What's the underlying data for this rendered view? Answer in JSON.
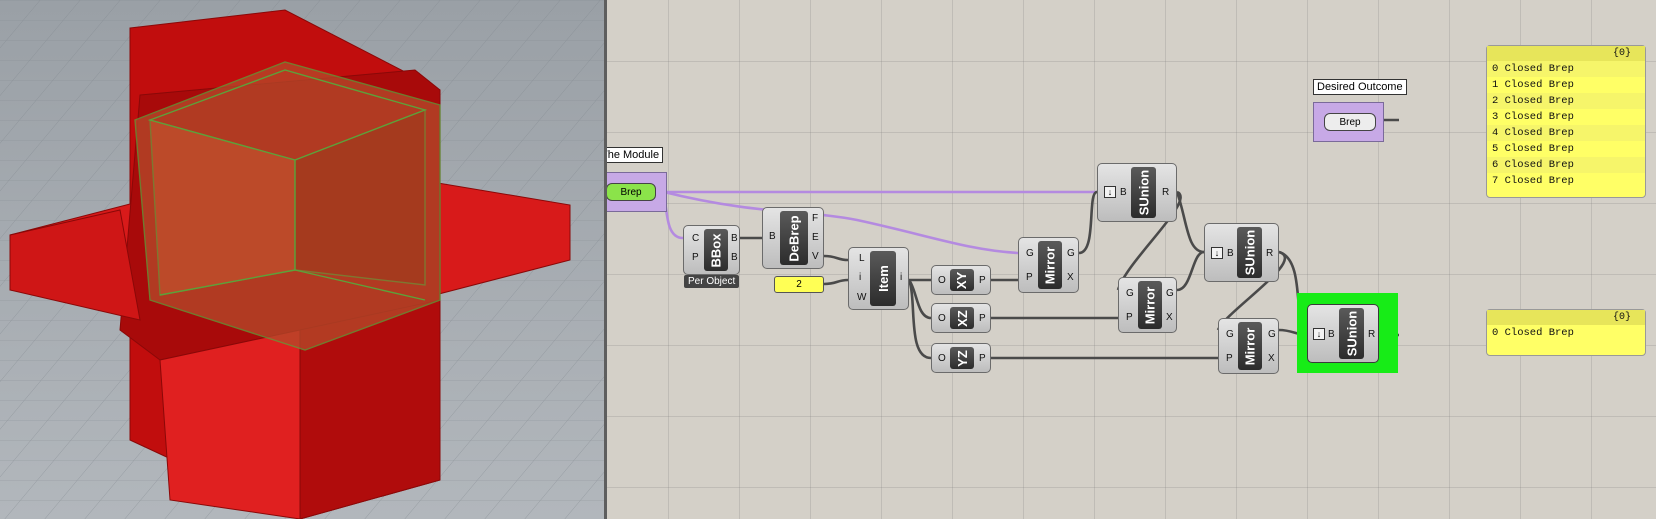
{
  "viewport": {
    "label": "Rhino 3D viewport",
    "object_color": "#d11414"
  },
  "canvas": {
    "wire_color": "#4a4a4a",
    "selected_wire_color": "#b48ae0",
    "highlight_color": "#17ec17"
  },
  "params": {
    "module": {
      "tag": "The Module",
      "label": "Brep"
    },
    "outcome": {
      "tag": "Desired Outcome",
      "label": "Brep"
    }
  },
  "bbox": {
    "name": "BBox",
    "in": [
      "C",
      "P"
    ],
    "out": [
      "B",
      "B"
    ],
    "badge": "Per Object"
  },
  "debrep": {
    "name": "DeBrep",
    "in": [
      "B"
    ],
    "out": [
      "F",
      "E",
      "V"
    ]
  },
  "slider": {
    "value": "2"
  },
  "item": {
    "name": "Item",
    "in": [
      "L",
      "i",
      "W"
    ],
    "out": [
      "i"
    ]
  },
  "planes": [
    {
      "name": "XY",
      "in": [
        "O"
      ],
      "out": [
        "P"
      ]
    },
    {
      "name": "XZ",
      "in": [
        "O"
      ],
      "out": [
        "P"
      ]
    },
    {
      "name": "YZ",
      "in": [
        "O"
      ],
      "out": [
        "P"
      ]
    }
  ],
  "mirrors": [
    {
      "name": "Mirror",
      "in": [
        "G",
        "P"
      ],
      "out": [
        "G",
        "X"
      ]
    },
    {
      "name": "Mirror",
      "in": [
        "G",
        "P"
      ],
      "out": [
        "G",
        "X"
      ]
    },
    {
      "name": "Mirror",
      "in": [
        "G",
        "P"
      ],
      "out": [
        "G",
        "X"
      ]
    }
  ],
  "sunions": [
    {
      "name": "SUnion",
      "in": [
        "B"
      ],
      "out": [
        "R"
      ]
    },
    {
      "name": "SUnion",
      "in": [
        "B"
      ],
      "out": [
        "R"
      ]
    },
    {
      "name": "SUnion",
      "in": [
        "B"
      ],
      "out": [
        "R"
      ]
    }
  ],
  "panels": {
    "top": {
      "header": "{0}",
      "rows": [
        "0 Closed Brep",
        "1 Closed Brep",
        "2 Closed Brep",
        "3 Closed Brep",
        "4 Closed Brep",
        "5 Closed Brep",
        "6 Closed Brep",
        "7 Closed Brep"
      ]
    },
    "bottom": {
      "header": "{0}",
      "rows": [
        "0 Closed Brep"
      ]
    }
  }
}
